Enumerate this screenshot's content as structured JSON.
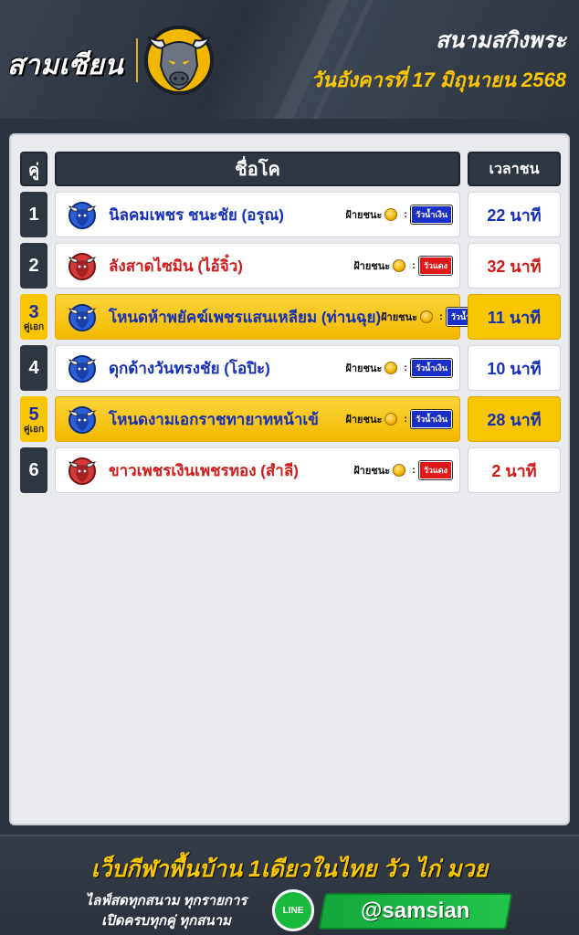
{
  "header": {
    "brand": "สามเซียน",
    "venue": "สนามสกิงพระ",
    "date": "วันอังคารที่ 17 มิถุนายน 2568"
  },
  "table": {
    "headers": {
      "pair": "คู่",
      "name": "ชื่อโค",
      "time": "เวลาชน"
    },
    "winner_label": "ฝ้ายชนะ",
    "colon": ":",
    "rows": [
      {
        "pair": "1",
        "tag": "",
        "name": "นิลคมเพชร ชนะชัย (อรุณ)",
        "team": "blue",
        "side": "วัวน้ำเงิน",
        "time": "22 นาที",
        "highlight": false
      },
      {
        "pair": "2",
        "tag": "",
        "name": "ลังสาดไซมิน (ไอ้จิ๋ว)",
        "team": "red",
        "side": "วัวแดง",
        "time": "32 นาที",
        "highlight": false
      },
      {
        "pair": "3",
        "tag": "คู่เอก",
        "name": "โหนดห้าพยัคฆ์เพชรแสนเหลียม (ท่านฉุย)",
        "team": "blue",
        "side": "วัวน้ำเงิน",
        "time": "11 นาที",
        "highlight": true
      },
      {
        "pair": "4",
        "tag": "",
        "name": "ดุกด้างวันทรงชัย (โอปิะ)",
        "team": "blue",
        "side": "วัวน้ำเงิน",
        "time": "10 นาที",
        "highlight": false
      },
      {
        "pair": "5",
        "tag": "คู่เอก",
        "name": "โหนดงามเอกราชทายาทหน้าเข้",
        "team": "blue",
        "side": "วัวน้ำเงิน",
        "time": "28 นาที",
        "highlight": true
      },
      {
        "pair": "6",
        "tag": "",
        "name": "ขาวเพชรเงินเพชรทอง (สำลี)",
        "team": "red",
        "side": "วัวแดง",
        "time": "2 นาที",
        "highlight": false
      }
    ]
  },
  "footer": {
    "tagline": "เว็บกีฬาพื้นบ้าน 1เดียวในไทย วัว ไก่ มวย",
    "sub1": "ไลฟ์สดทุกสนาม ทุกรายการ",
    "sub2": "เปิดครบทุกคู่ ทุกสนาม",
    "line_label": "LINE",
    "handle": "@samsian"
  },
  "colors": {
    "accent": "#f7c600",
    "blue_team": "#1730b8",
    "red_team": "#d21a1a",
    "dark": "#2e3642"
  },
  "icons": {
    "blue": "blue-bull-icon",
    "red": "red-bull-icon",
    "logo": "bull-logo-icon",
    "line": "line-app-icon"
  }
}
